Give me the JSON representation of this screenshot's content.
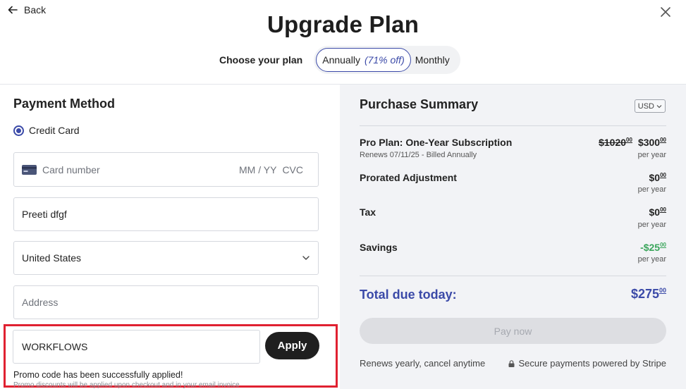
{
  "header": {
    "back_label": "Back",
    "title": "Upgrade Plan",
    "choose_label": "Choose your plan",
    "annual_label": "Annually",
    "annual_discount": "(71% off)",
    "monthly_label": "Monthly"
  },
  "payment": {
    "title": "Payment Method",
    "method_label": "Credit Card",
    "card_placeholder": "Card number",
    "expiry_placeholder": "MM / YY",
    "cvc_placeholder": "CVC",
    "name_value": "Preeti dfgf",
    "country_value": "United States",
    "address_placeholder": "Address",
    "promo_value": "WORKFLOWS",
    "apply_label": "Apply",
    "promo_success": "Promo code has been successfully applied!",
    "promo_note": "Promo discounts will be applied upon checkout and in your email invoice"
  },
  "summary": {
    "title": "Purchase Summary",
    "currency": "USD",
    "items": [
      {
        "label": "Pro Plan: One-Year Subscription",
        "sub": "Renews 07/11/25 - Billed Annually",
        "old_price": "$1020",
        "old_cents": "00",
        "price": "$300",
        "cents": "00",
        "per": "per year"
      },
      {
        "label": "Prorated Adjustment",
        "price": "$0",
        "cents": "00",
        "per": "per year"
      },
      {
        "label": "Tax",
        "price": "$0",
        "cents": "00",
        "per": "per year"
      },
      {
        "label": "Savings",
        "price": "-$25",
        "cents": "00",
        "per": "per year"
      }
    ],
    "total_label": "Total due today:",
    "total_price": "$275",
    "total_cents": "00",
    "pay_label": "Pay now",
    "renew_note": "Renews yearly, cancel anytime",
    "secure_note": "Secure payments powered by Stripe"
  },
  "colors": {
    "accent": "#3b4aa8",
    "savings": "#3aa55b",
    "highlight_border": "#e02131"
  }
}
